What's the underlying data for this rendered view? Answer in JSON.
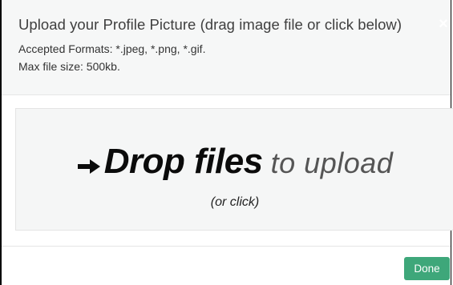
{
  "modal": {
    "title": "Upload your Profile Picture (drag image file or click below)",
    "close_label": "×",
    "accepted_formats": "Accepted Formats: *.jpeg, *.png, *.gif.",
    "max_file_size": "Max file size: 500kb."
  },
  "dropzone": {
    "arrow_icon": "arrow-right-icon",
    "primary_text": "Drop files",
    "secondary_text": "to upload",
    "hint_text": "(or click)"
  },
  "footer": {
    "done_label": "Done"
  },
  "colors": {
    "header_bg": "#f6f7f7",
    "dropzone_bg": "#f5f6f6",
    "done_button": "#3ea77a"
  }
}
